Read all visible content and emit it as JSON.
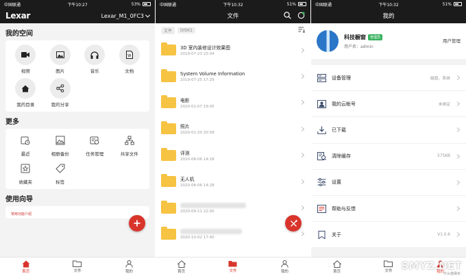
{
  "screen1": {
    "status": {
      "carrier": "中国联通",
      "time": "下午10:27",
      "battery": "53%"
    },
    "header": {
      "logo": "Lexar",
      "device": "Lexar_M1_0FC3"
    },
    "my_space": {
      "title": "我的空间",
      "items": [
        {
          "label": "视频",
          "icon": "video-icon"
        },
        {
          "label": "图片",
          "icon": "image-icon"
        },
        {
          "label": "音乐",
          "icon": "headphones-icon"
        },
        {
          "label": "文档",
          "icon": "document-icon"
        },
        {
          "label": "我的目录",
          "icon": "home-icon"
        },
        {
          "label": "我的分享",
          "icon": "share-icon"
        }
      ]
    },
    "more": {
      "title": "更多",
      "items": [
        {
          "label": "最近",
          "icon": "recent-icon"
        },
        {
          "label": "相册备份",
          "icon": "album-backup-icon"
        },
        {
          "label": "任务管理",
          "icon": "task-icon"
        },
        {
          "label": "共享文件",
          "icon": "network-share-icon"
        },
        {
          "label": "收藏夹",
          "icon": "favorite-icon"
        },
        {
          "label": "标签",
          "icon": "tag-icon"
        }
      ]
    },
    "guide": {
      "title": "使用向导",
      "snippet": "常用功能介绍"
    }
  },
  "screen2": {
    "status": {
      "carrier": "中国联通",
      "time": "下午10:32",
      "battery": "51%"
    },
    "header": {
      "title": "文件"
    },
    "breadcrumb": [
      "文件",
      "DISK1"
    ],
    "files": [
      {
        "name": "3D 室内装修设计效果图",
        "date": "2019-07-23 23:04"
      },
      {
        "name": "System Volume Information",
        "date": "2019-07-25 17:29"
      },
      {
        "name": "电影",
        "date": "2020-01-07 19:05"
      },
      {
        "name": "照片",
        "date": "2020-01-20 20:58"
      },
      {
        "name": "评测",
        "date": "2020-08-06 14:18"
      },
      {
        "name": "无人机",
        "date": "2020-08-06 14:28"
      },
      {
        "name": "",
        "date": "2020-09-11 22:00"
      },
      {
        "name": "",
        "date": "2020-10-02 17:40"
      }
    ]
  },
  "screen3": {
    "status": {
      "carrier": "中国联通",
      "time": "下午10:32",
      "battery": "51%"
    },
    "header": {
      "title": "我的"
    },
    "profile": {
      "name": "科技橱窗",
      "badge": "管理员",
      "username": "用户名：admin",
      "manage": "用户管理"
    },
    "menu": [
      {
        "label": "设备管理",
        "value": "磁盘、系统",
        "icon": "device-icon"
      },
      {
        "label": "我的云帐号",
        "value": "未绑定",
        "icon": "cloud-account-icon"
      },
      {
        "label": "已下载",
        "value": "",
        "icon": "download-icon"
      },
      {
        "label": "清除缓存",
        "value": "575KB",
        "icon": "clear-cache-icon"
      },
      {
        "label": "设置",
        "value": "",
        "icon": "settings-icon"
      },
      {
        "label": "帮助与反馈",
        "value": "",
        "icon": "help-icon"
      },
      {
        "label": "关于",
        "value": "V1.0.6",
        "icon": "about-icon"
      }
    ]
  },
  "tabs": [
    {
      "label": "首页"
    },
    {
      "label": "文件"
    },
    {
      "label": "我的"
    }
  ],
  "watermark": {
    "main": "SMYZ.NET",
    "sub": "什么值得买"
  },
  "colors": {
    "accent": "#d9342b",
    "folder": "#f6c343",
    "bar": "#1b1b1b"
  }
}
